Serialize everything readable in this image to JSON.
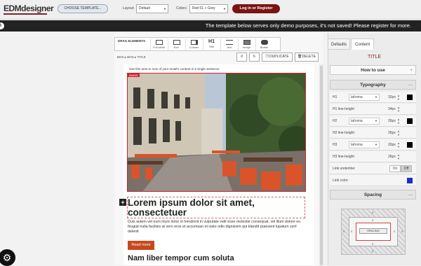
{
  "header": {
    "logo": "EDMdesigner",
    "choose_template": "CHOOSE TEMPLATE...",
    "layout_label": "Layout:",
    "layout_value": "Default",
    "colors_label": "Colors:",
    "colors_value": "Red 01 + Grey",
    "login": "Log in or Register"
  },
  "banner": {
    "info": "i",
    "text": "The template below serves only demo purposes, it's not saved! Please register for more."
  },
  "toolbar": {
    "drag_label": "DRAG ELEMENTS",
    "tools": [
      "Full width",
      "Box",
      "Column",
      "Title",
      "Text",
      "Image",
      "Button"
    ],
    "title_glyph": "H1",
    "duplicate": "DUPLICATE",
    "delete": "DELETE"
  },
  "breadcrumb": "BOX ▸ BOX ▸ TITLE",
  "content": {
    "caption": "Use this area to sum of your email's content in a single sentence.",
    "image_tag": "IMAGE",
    "heading": "Lorem ipsum dolor sit amet, consectetuer",
    "paragraph": "Duis autem vel eum iriure dolor in hendrerit in vulputate velit esse molestie consequat, vel illum dolore eu feugiat nulla facilisis at vero eros et accumsan et iusto odio dignissim qui blandit praesent lupatum zzril delenit",
    "read_more": "Read more",
    "heading2": "Nam liber tempor cum soluta"
  },
  "panel": {
    "tabs": [
      "Defaults",
      "Content"
    ],
    "active_tab": "Content",
    "title": "TITLE",
    "how_to_use": "How to use",
    "typography": "Typography",
    "rows": [
      {
        "k": "H1",
        "font": "tahoma",
        "size": "32px",
        "color": "#000000"
      },
      {
        "k": "H1 line-height",
        "size": "34px"
      },
      {
        "k": "H2",
        "font": "tahoma",
        "size": "26px",
        "color": "#000000"
      },
      {
        "k": "H2 line-height",
        "size": "26px"
      },
      {
        "k": "H3",
        "font": "tahoma",
        "size": "20px",
        "color": "#000000"
      },
      {
        "k": "H3 line-height",
        "size": "26px"
      }
    ],
    "link_underline": "Link underline:",
    "on": "On",
    "off": "Off",
    "link_color": "Link color:",
    "link_color_value": "#1a2ecc",
    "spacing": "Spacing",
    "spacing_label": "SPACING",
    "zero": "0",
    "plus": "+",
    "minus": "—"
  },
  "colors": {
    "accent": "#7a1414",
    "banner": "#222222",
    "button": "#c8481c"
  }
}
